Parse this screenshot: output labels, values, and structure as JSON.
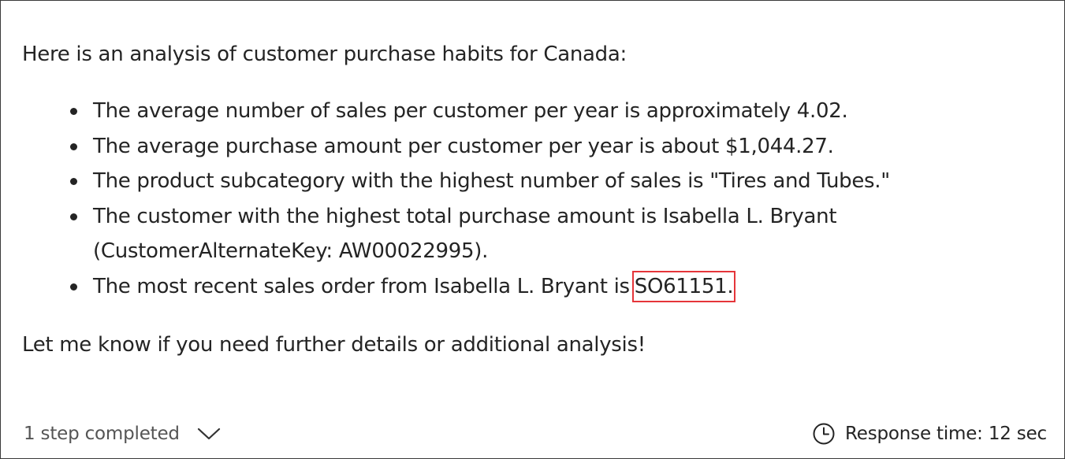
{
  "message": {
    "intro": "Here is an analysis of customer purchase habits for Canada:",
    "bullets": [
      {
        "text": "The average number of sales per customer per year is approximately 4.02."
      },
      {
        "text": "The average purchase amount per customer per year is about $1,044.27."
      },
      {
        "text": "The product subcategory with the highest number of sales is \"Tires and Tubes.\""
      },
      {
        "line1": "The customer with the highest total purchase amount is Isabella L. Bryant",
        "line2": "(CustomerAlternateKey: AW00022995)."
      },
      {
        "text": "The most recent sales order from Isabella L. Bryant is",
        "highlight": "SO61151."
      }
    ],
    "outro": "Let me know if you need further details or additional analysis!"
  },
  "footer": {
    "steps_label": "1 step completed",
    "steps_icon": "chevron-down-icon",
    "response_icon": "clock-icon",
    "response_time": "Response time: 12 sec"
  },
  "colors": {
    "text": "#242424",
    "muted": "#555555",
    "highlight_border": "#e5353a",
    "frame_border": "#3a3a3a"
  }
}
